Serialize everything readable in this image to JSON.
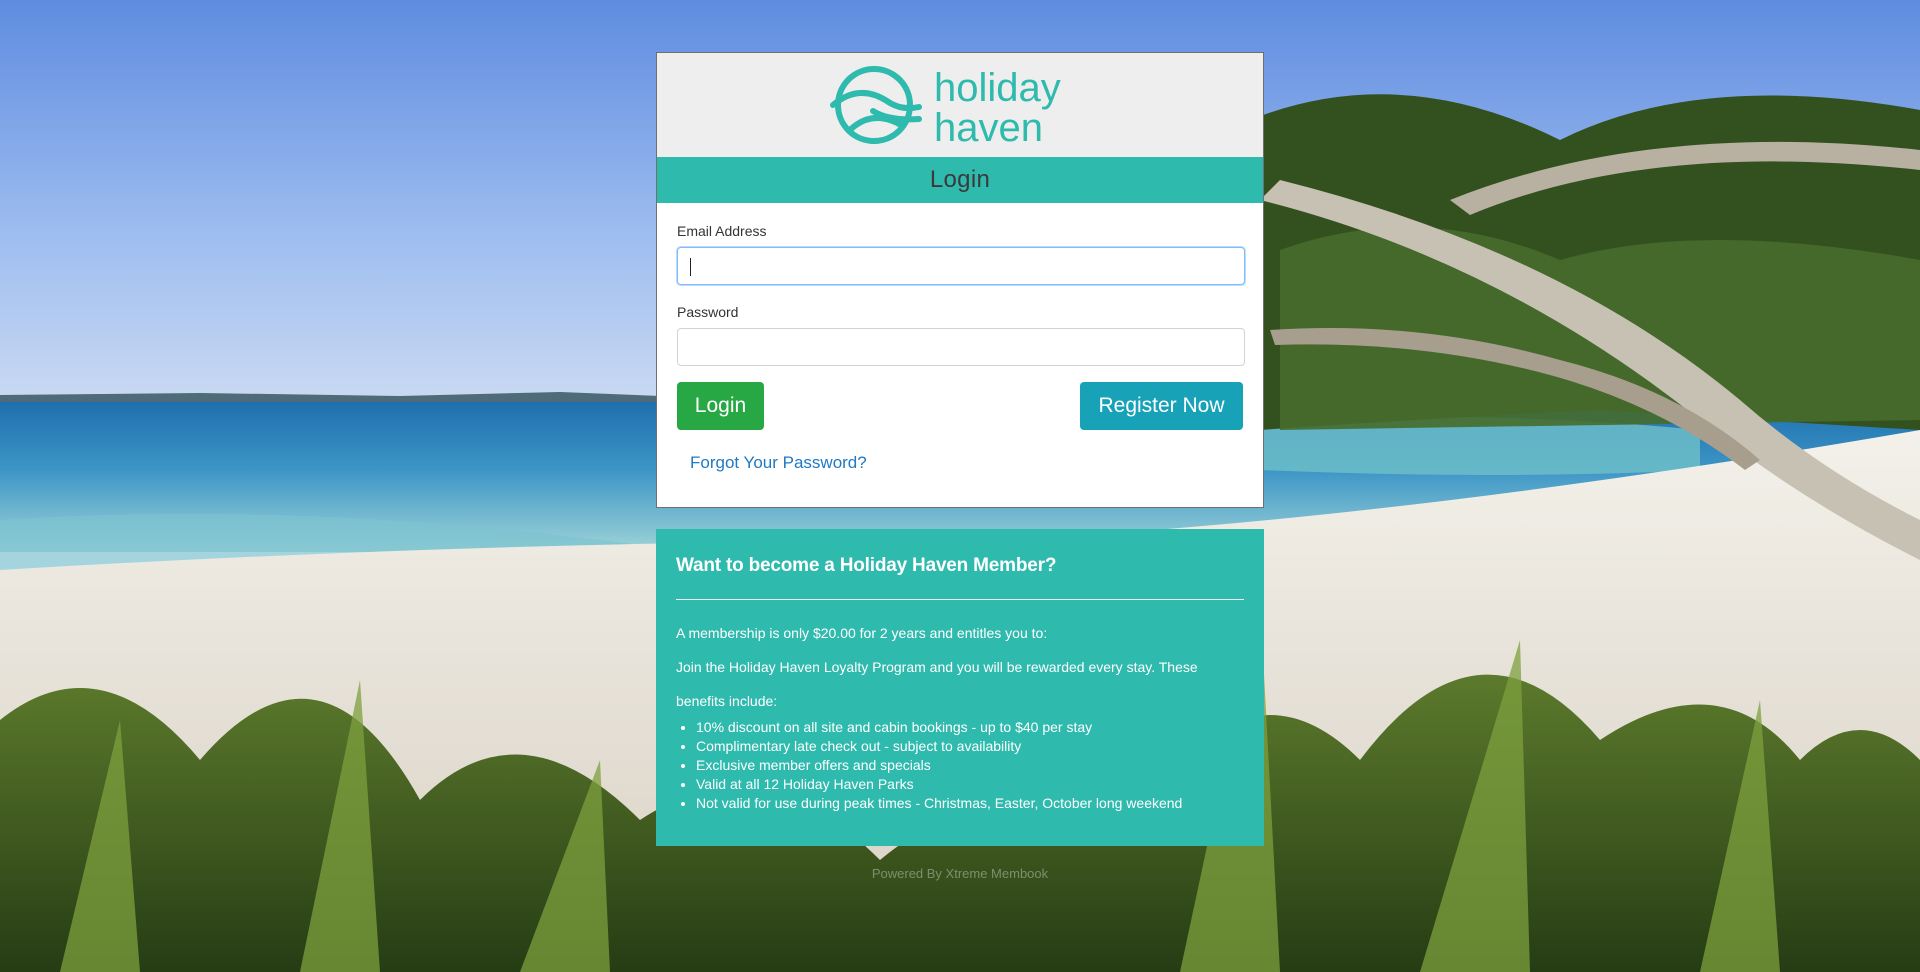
{
  "brand": {
    "logo_line1": "holiday",
    "logo_line2": "haven",
    "color": "#2fbaae"
  },
  "login": {
    "title": "Login",
    "email_label": "Email Address",
    "email_value": "",
    "password_label": "Password",
    "password_value": "",
    "login_button": "Login",
    "register_button": "Register Now",
    "forgot_link": "Forgot Your Password?"
  },
  "membership": {
    "heading": "Want to become a Holiday Haven Member?",
    "intro": "A membership is only $20.00 for 2 years and entitles you to:",
    "loyalty_line1": "Join the Holiday Haven Loyalty Program and you will be rewarded every stay. These",
    "loyalty_line2": "benefits include:",
    "benefits": [
      "10% discount on all site and cabin bookings - up to $40 per stay",
      "Complimentary late check out - subject to availability",
      "Exclusive member offers and specials",
      "Valid at all 12 Holiday Haven Parks",
      "Not valid for use during peak times - Christmas, Easter, October long weekend"
    ]
  },
  "footer": {
    "powered_by": "Powered By Xtreme Membook"
  },
  "colors": {
    "login_green": "#28a745",
    "register_teal": "#17a2b8",
    "link_blue": "#1f79c4"
  }
}
